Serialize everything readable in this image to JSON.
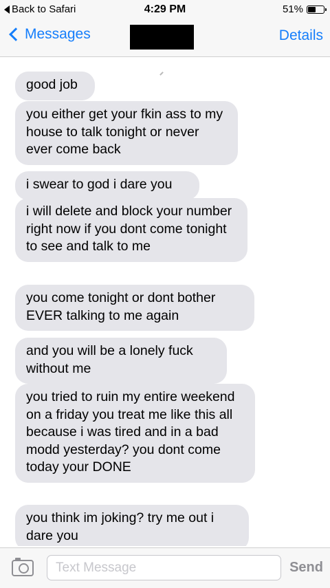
{
  "status_bar": {
    "back_label": "Back to Safari",
    "time": "4:29 PM",
    "battery_text": "51%",
    "battery_level": 0.51
  },
  "nav": {
    "back_label": "Messages",
    "details_label": "Details"
  },
  "messages": [
    "good job",
    "you either get your fkin ass to my house to talk tonight or never ever come back",
    "i swear to god i dare you",
    "i will delete and block your number right now if you dont come tonight to see and talk to me",
    "you come tonight or dont bother EVER talking to me again",
    "and you will be a lonely fuck without me",
    "you tried to ruin my entire weekend on a friday you treat me like this all because i was tired and in a bad modd yesterday? you dont come today your DONE",
    "you think im joking? try me out i dare you"
  ],
  "input_bar": {
    "placeholder": "Text Message",
    "send_label": "Send"
  },
  "colors": {
    "accent": "#157efb",
    "bubble_incoming": "#e5e5ea",
    "bar_background": "#f7f7f7"
  },
  "icons": {
    "back": "back-to-app-icon",
    "chevron": "chevron-left-icon",
    "camera": "camera-icon",
    "battery": "battery-icon"
  }
}
